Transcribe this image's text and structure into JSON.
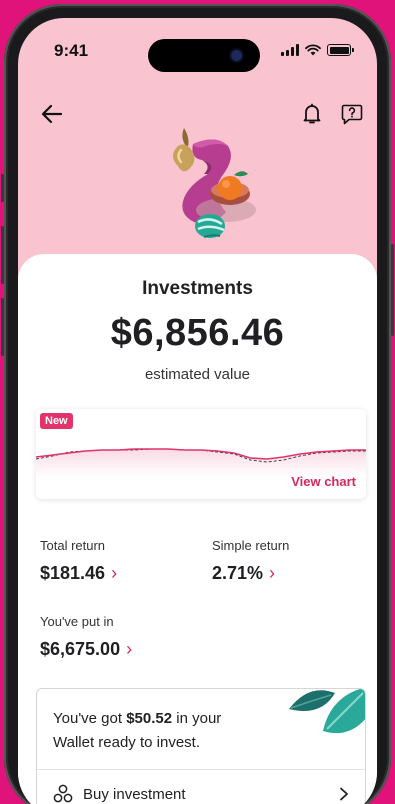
{
  "status_bar": {
    "time": "9:41"
  },
  "colors": {
    "accent": "#d7285d",
    "hero_bg": "#f9c3cf",
    "frame": "#e0137a"
  },
  "icons": {
    "back": "arrow-left-icon",
    "notifications": "bell-icon",
    "help": "help-chat-icon",
    "buy": "stacked-coins-icon",
    "chevron": "chevron-right-icon"
  },
  "summary": {
    "title": "Investments",
    "value": "$6,856.46",
    "subtitle": "estimated value"
  },
  "chart": {
    "badge": "New",
    "link": "View chart"
  },
  "chart_data": {
    "type": "line",
    "title": "",
    "xlabel": "",
    "ylabel": "",
    "x": [
      0,
      1,
      2,
      3,
      4,
      5,
      6,
      7,
      8,
      9,
      10,
      11,
      12,
      13,
      14,
      15,
      16,
      17,
      18,
      19,
      20
    ],
    "series": [
      {
        "values": [
          40,
          42,
          44,
          46,
          47,
          47,
          48,
          48,
          48,
          47,
          47,
          46,
          44,
          39,
          38,
          40,
          43,
          45,
          46,
          47,
          47
        ]
      },
      {
        "values": [
          38,
          41,
          45,
          46,
          47,
          47,
          47,
          48,
          48,
          47,
          47,
          45,
          43,
          37,
          35,
          37,
          41,
          44,
          45,
          46,
          46
        ]
      }
    ],
    "ylim": [
      20,
      70
    ],
    "grid": false,
    "line_styles": [
      "solid",
      "dashed"
    ],
    "series_colors": [
      "#e2336b",
      "#444444"
    ]
  },
  "stats": {
    "total_return": {
      "label": "Total return",
      "value": "$181.46"
    },
    "simple_return": {
      "label": "Simple return",
      "value": "2.71%"
    },
    "put_in": {
      "label": "You've put in",
      "value": "$6,675.00"
    }
  },
  "wallet": {
    "text_before": "You've got",
    "amount": "$50.52",
    "text_after": "in your Wallet ready to invest."
  },
  "buy": {
    "label": "Buy investment"
  }
}
